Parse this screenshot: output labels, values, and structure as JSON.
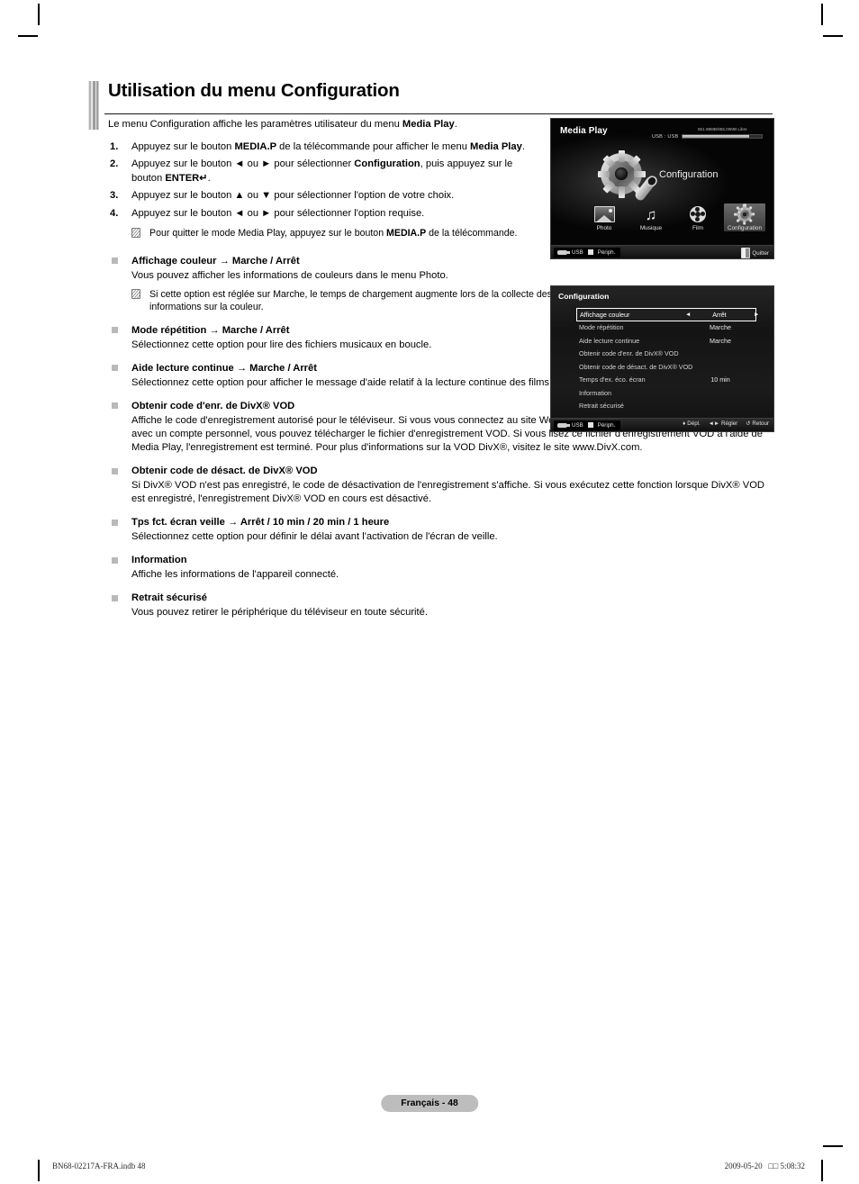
{
  "page_title": "Utilisation du menu Configuration",
  "intro": {
    "before": "Le menu Configuration affiche les paramètres utilisateur du menu ",
    "bold": "Media Play",
    "after": "."
  },
  "steps": [
    {
      "num": "1.",
      "parts": [
        {
          "t": "Appuyez sur le bouton ",
          "b": false
        },
        {
          "t": "MEDIA.P",
          "b": true
        },
        {
          "t": " de la télécommande pour afficher le menu ",
          "b": false
        },
        {
          "t": "Media Play",
          "b": true
        },
        {
          "t": ".",
          "b": false
        }
      ]
    },
    {
      "num": "2.",
      "parts": [
        {
          "t": "Appuyez sur le bouton ◄ ou ► pour sélectionner ",
          "b": false
        },
        {
          "t": "Configuration",
          "b": true
        },
        {
          "t": ", puis appuyez sur le bouton ",
          "b": false
        },
        {
          "t": "ENTER",
          "b": true
        },
        {
          "t": "↵",
          "b": true
        },
        {
          "t": ".",
          "b": false
        }
      ]
    },
    {
      "num": "3.",
      "parts": [
        {
          "t": "Appuyez sur le bouton ▲ ou ▼ pour sélectionner l'option de votre choix.",
          "b": false
        }
      ]
    },
    {
      "num": "4.",
      "parts": [
        {
          "t": "Appuyez sur le bouton ◄ ou ► pour sélectionner l'option requise.",
          "b": false
        }
      ]
    }
  ],
  "step_note": {
    "parts": [
      {
        "t": "Pour quitter le mode Media Play, appuyez sur le bouton ",
        "b": false
      },
      {
        "t": "MEDIA.P",
        "b": true
      },
      {
        "t": " de la télécommande.",
        "b": false
      }
    ]
  },
  "bullets": [
    {
      "heading": "Affichage couleur → Marche / Arrêt",
      "body": "Vous pouvez afficher les informations de couleurs dans le menu Photo.",
      "narrow": true,
      "note": "Si cette option est réglée sur Marche, le temps de chargement augmente lors de la collecte des informations sur la couleur."
    },
    {
      "heading": "Mode répétition → Marche / Arrêt",
      "body": "Sélectionnez cette option pour lire des fichiers musicaux en boucle.",
      "narrow": true,
      "note": null
    },
    {
      "heading": "Aide lecture continue → Marche / Arrêt",
      "body": "Sélectionnez cette option pour afficher le message d'aide relatif à la lecture continue des films.",
      "narrow": true,
      "note": null
    },
    {
      "heading": "Obtenir code d'enr. de DivX® VOD",
      "body": "Affiche le code d'enregistrement autorisé pour le téléviseur. Si vous vous connectez au site Web DivX et enregistrez le code d'enregistrement avec un compte personnel, vous pouvez télécharger le fichier d'enregistrement VOD. Si vous lisez ce fichier d'enregistrement VOD à l'aide de Media Play, l'enregistrement est terminé. Pour plus d'informations sur la VOD DivX®, visitez le site www.DivX.com.",
      "narrow": false,
      "note": null
    },
    {
      "heading": "Obtenir code de désact. de DivX® VOD",
      "body": "Si DivX® VOD n'est pas enregistré, le code de désactivation de l'enregistrement s'affiche. Si vous exécutez cette fonction lorsque DivX® VOD est enregistré, l'enregistrement DivX® VOD en cours est désactivé.",
      "narrow": false,
      "note": null
    },
    {
      "heading": "Tps fct. écran veille → Arrêt / 10 min / 20 min / 1 heure",
      "body": "Sélectionnez cette option pour définir le délai avant l'activation de l'écran de veille.",
      "narrow": false,
      "note": null
    },
    {
      "heading": "Information",
      "body": "Affiche les informations de l'appareil connecté.",
      "narrow": false,
      "note": null
    },
    {
      "heading": "Retrait sécurisé",
      "body": "Vous pouvez retirer le périphérique du téléviseur en toute sécurité.",
      "narrow": false,
      "note": null
    }
  ],
  "media_play_osd": {
    "title": "Media Play",
    "usb_label": "USB : USB",
    "free_space": "851.98MB/955.00MB Libre",
    "hero_label": "Configuration",
    "icons": [
      {
        "label": "Photo",
        "icon": "photo-icon",
        "selected": false
      },
      {
        "label": "Musique",
        "icon": "music-note-icon",
        "selected": false
      },
      {
        "label": "Film",
        "icon": "film-reel-icon",
        "selected": false
      },
      {
        "label": "Configuration",
        "icon": "gear-icon",
        "selected": true
      }
    ],
    "footer": {
      "usb": "USB",
      "device": "Périph.",
      "exit": "Quitter"
    }
  },
  "config_osd": {
    "title": "Configuration",
    "rows": [
      {
        "label": "Affichage couleur",
        "value": "Arrêt",
        "selected": true
      },
      {
        "label": "Mode répétition",
        "value": "Marche",
        "selected": false
      },
      {
        "label": "Aide lecture continue",
        "value": "Marche",
        "selected": false
      },
      {
        "label": "Obtenir code d'enr. de DivX® VOD",
        "value": "",
        "selected": false
      },
      {
        "label": "Obtenir code de désact. de DivX® VOD",
        "value": "",
        "selected": false
      },
      {
        "label": "Temps d'ex. éco. écran",
        "value": "10 min",
        "selected": false
      },
      {
        "label": "Information",
        "value": "",
        "selected": false
      },
      {
        "label": "Retrait sécurisé",
        "value": "",
        "selected": false
      }
    ],
    "footer": {
      "usb": "USB",
      "device": "Périph.",
      "hints": [
        {
          "glyph": "♦",
          "label": "Dépl."
        },
        {
          "glyph": "◄►",
          "label": "Régler"
        },
        {
          "glyph": "↺",
          "label": "Retour"
        }
      ]
    }
  },
  "page_badge": "Français - 48",
  "footer_left": "BN68-02217A-FRA.indb   48",
  "footer_right": "2009-05-20   □□ 5:08:32"
}
